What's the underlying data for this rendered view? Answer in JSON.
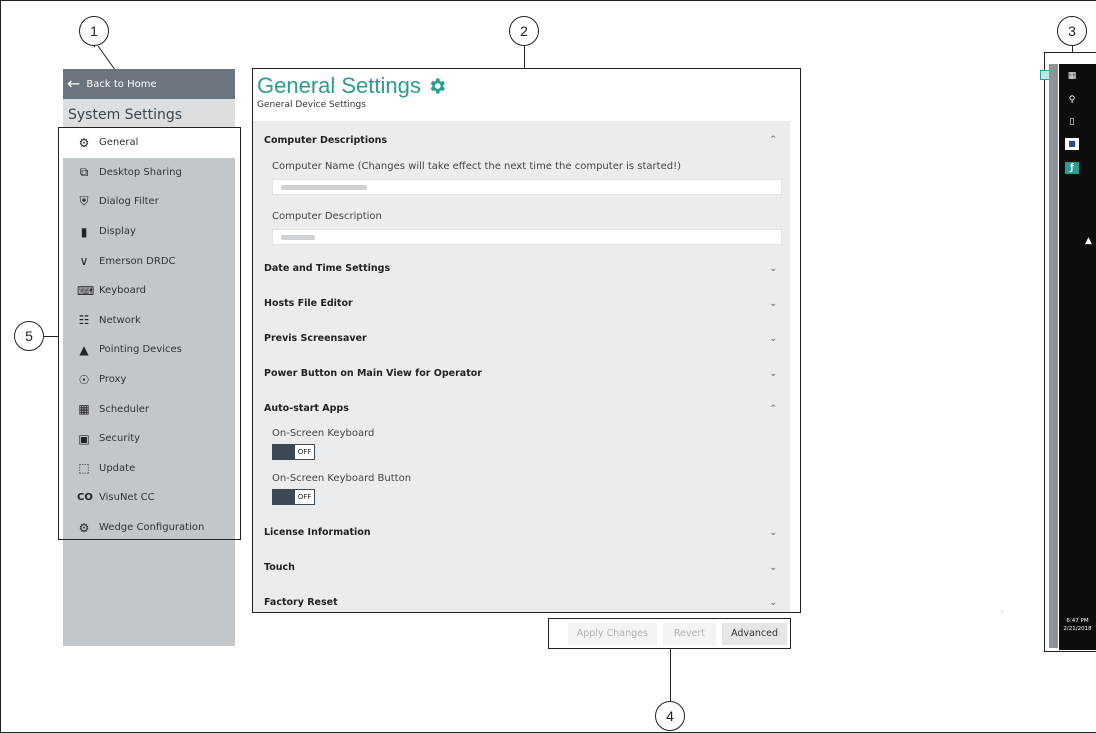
{
  "callouts": [
    "1",
    "2",
    "3",
    "4",
    "5"
  ],
  "sidebar": {
    "back_label": "Back to Home",
    "title": "System Settings",
    "items": [
      {
        "label": "General",
        "icon": "gear-icon"
      },
      {
        "label": "Desktop Sharing",
        "icon": "desktop-sharing-icon"
      },
      {
        "label": "Dialog Filter",
        "icon": "shield-icon"
      },
      {
        "label": "Display",
        "icon": "display-icon"
      },
      {
        "label": "Emerson DRDC",
        "icon": "chevron-icon"
      },
      {
        "label": "Keyboard",
        "icon": "keyboard-icon"
      },
      {
        "label": "Network",
        "icon": "network-icon"
      },
      {
        "label": "Pointing Devices",
        "icon": "mouse-icon"
      },
      {
        "label": "Proxy",
        "icon": "globe-icon"
      },
      {
        "label": "Scheduler",
        "icon": "calendar-icon"
      },
      {
        "label": "Security",
        "icon": "lock-icon"
      },
      {
        "label": "Update",
        "icon": "update-icon"
      },
      {
        "label": "VisuNet CC",
        "icon": "link-icon"
      },
      {
        "label": "Wedge Configuration",
        "icon": "wedge-icon"
      }
    ]
  },
  "main": {
    "title": "General Settings",
    "subtitle": "General Device Settings",
    "sections": {
      "computer": {
        "title": "Computer Descriptions",
        "name_label": "Computer Name (Changes will take effect the next time the computer is started!)",
        "desc_label": "Computer Description"
      },
      "datetime": "Date and Time Settings",
      "hosts": "Hosts File Editor",
      "previs": "Previs Screensaver",
      "power": "Power Button on Main View for Operator",
      "autostart": {
        "title": "Auto-start Apps",
        "kb_label": "On-Screen Keyboard",
        "kb_state": "OFF",
        "kbbtn_label": "On-Screen Keyboard Button",
        "kbbtn_state": "OFF"
      },
      "license": "License Information",
      "touch": "Touch",
      "reset": "Factory Reset"
    }
  },
  "buttons": {
    "apply": "Apply Changes",
    "revert": "Revert",
    "advanced": "Advanced"
  },
  "taskbar": {
    "time": "6:47 PM",
    "date": "2/21/2018"
  },
  "colors": {
    "accent": "#2a9d8f",
    "sidebar_bg": "#c2c7cb",
    "back_bar": "#6a7580"
  }
}
